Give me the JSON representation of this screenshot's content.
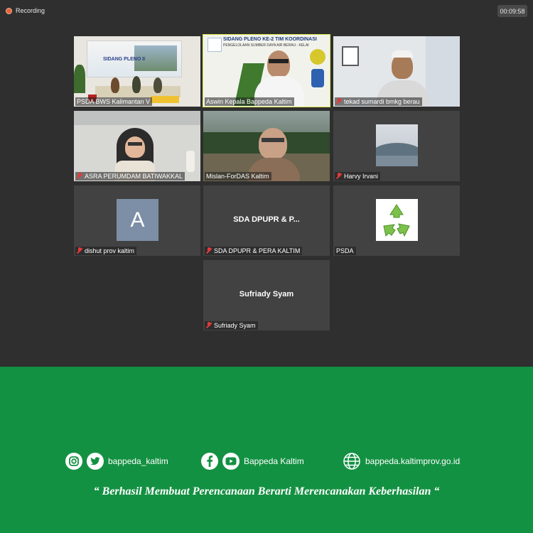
{
  "recording": {
    "label": "Recording"
  },
  "timer": {
    "value": "00:09:58"
  },
  "tiles": [
    {
      "name": "PSDA BWS Kalimantan V",
      "muted": false,
      "banner": "SIDANG PLENO II"
    },
    {
      "name": "Aswin Kepala Bappeda Kaltim",
      "muted": false,
      "slide_title": "SIDANG PLENO KE-2 TIM KOORDINASI",
      "slide_sub": "PENGELOLAAN SUMBER DAYA AIR BERAU - KELAI"
    },
    {
      "name": "tekad sumardi bmkg berau",
      "muted": true
    },
    {
      "name": "ASRA PERUMDAM BATIWAKKAL",
      "muted": true
    },
    {
      "name": "Mislan-ForDAS Kaltim",
      "muted": false
    },
    {
      "name": "Harvy Irvani",
      "muted": true
    },
    {
      "name": "dishut prov kaltim",
      "muted": true,
      "avatar_letter": "A"
    },
    {
      "name": "SDA DPUPR & PERA KALTIM",
      "muted": true,
      "center": "SDA DPUPR & P..."
    },
    {
      "name": "PSDA",
      "muted": false
    },
    {
      "name": "Sufriady Syam",
      "muted": true,
      "center": "Sufriady Syam"
    }
  ],
  "footer": {
    "instagram_twitter_handle": "bappeda_kaltim",
    "facebook_youtube_handle": "Bappeda Kaltim",
    "website": "bappeda.kaltimprov.go.id",
    "tagline": "“ Berhasil  Membuat Perencanaan Berarti Merencanakan Keberhasilan “",
    "icons": [
      "instagram-icon",
      "twitter-icon",
      "facebook-icon",
      "youtube-icon",
      "globe-icon"
    ]
  },
  "colors": {
    "meeting_bg": "#2f2f2f",
    "tile_bg": "#424242",
    "active_speaker": "#d9e84a",
    "muted_mic": "#e23a3a",
    "footer_green": "#139142"
  }
}
